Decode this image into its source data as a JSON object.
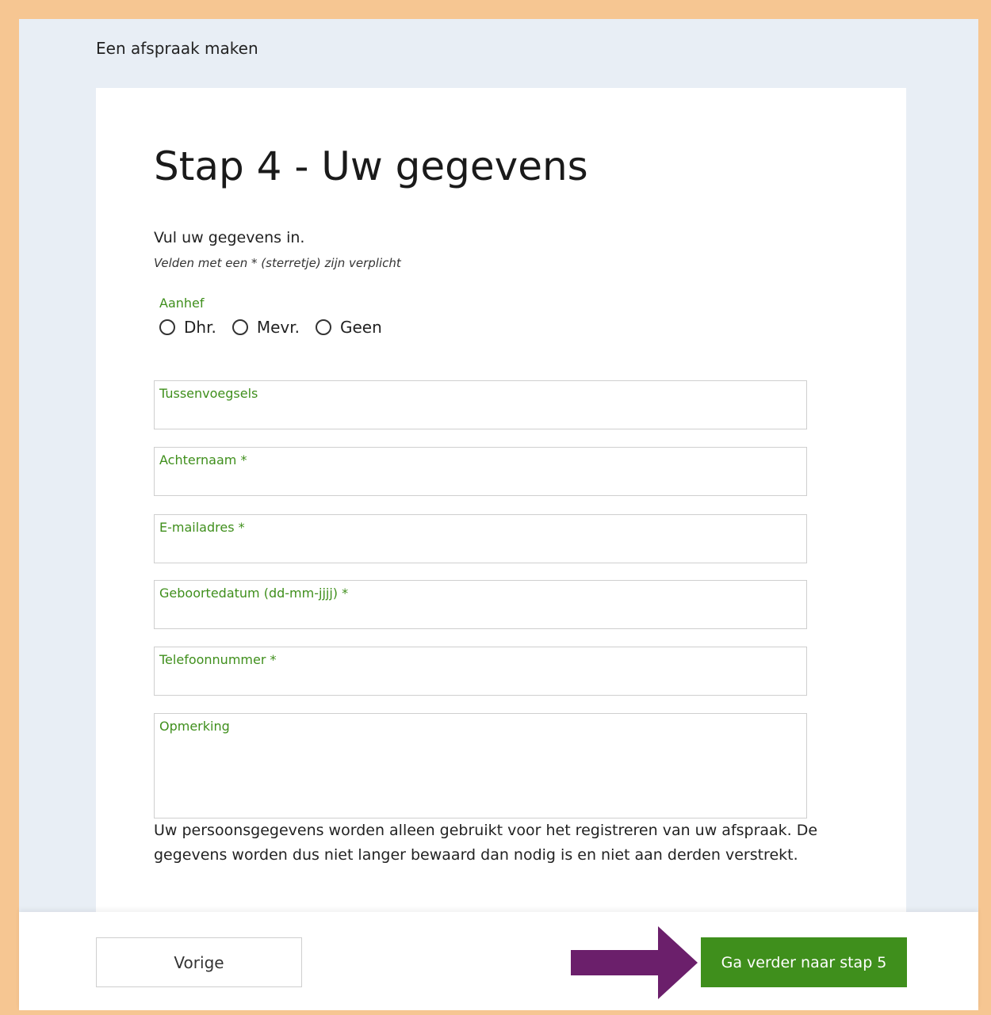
{
  "header": {
    "title": "Een afspraak maken"
  },
  "form": {
    "title": "Stap 4 - Uw gegevens",
    "intro": "Vul uw gegevens in.",
    "required_note": "Velden met een * (sterretje) zijn verplicht",
    "salutation": {
      "label": "Aanhef",
      "options": [
        "Dhr.",
        "Mevr.",
        "Geen"
      ]
    },
    "fields": {
      "infix": {
        "label": "Tussenvoegsels",
        "value": ""
      },
      "last_name": {
        "label": "Achternaam *",
        "value": ""
      },
      "email": {
        "label": "E-mailadres *",
        "value": ""
      },
      "birth_date": {
        "label": "Geboortedatum (dd-mm-jjjj) *",
        "value": ""
      },
      "phone": {
        "label": "Telefoonnummer *",
        "value": ""
      },
      "remark": {
        "label": "Opmerking",
        "value": ""
      }
    },
    "privacy_text": "Uw persoonsgegevens worden alleen gebruikt voor het registreren van uw afspraak. De gegevens worden dus niet langer bewaard dan nodig is en niet aan derden verstrekt."
  },
  "footer": {
    "prev_label": "Vorige",
    "next_label": "Ga verder naar stap 5"
  },
  "colors": {
    "border_highlight": "#f6c692",
    "background": "#e8eef5",
    "accent_green": "#3f8f1c",
    "arrow_purple": "#6b1f6b"
  },
  "icons": {
    "annotation_arrow": "arrow-right-icon",
    "radio": "radio-unchecked-icon"
  }
}
